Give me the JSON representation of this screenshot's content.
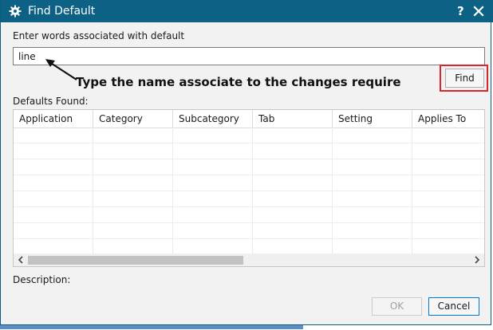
{
  "window": {
    "title": "Find Default",
    "help_glyph": "?",
    "icons": {
      "app": "gear-icon",
      "help": "help-icon",
      "close": "close-icon"
    },
    "colors": {
      "titlebar": "#0d6185",
      "highlight": "#d9262c",
      "focus": "#0078d7"
    }
  },
  "search": {
    "label": "Enter words associated with default",
    "value": "line",
    "find_label": "Find"
  },
  "annotation": {
    "text": "Type the name associate to the changes require"
  },
  "results": {
    "label": "Defaults Found:",
    "columns": [
      "Application",
      "Category",
      "Subcategory",
      "Tab",
      "Setting",
      "Applies To"
    ],
    "rows": []
  },
  "description": {
    "label": "Description:"
  },
  "footer": {
    "ok_label": "OK",
    "cancel_label": "Cancel"
  }
}
